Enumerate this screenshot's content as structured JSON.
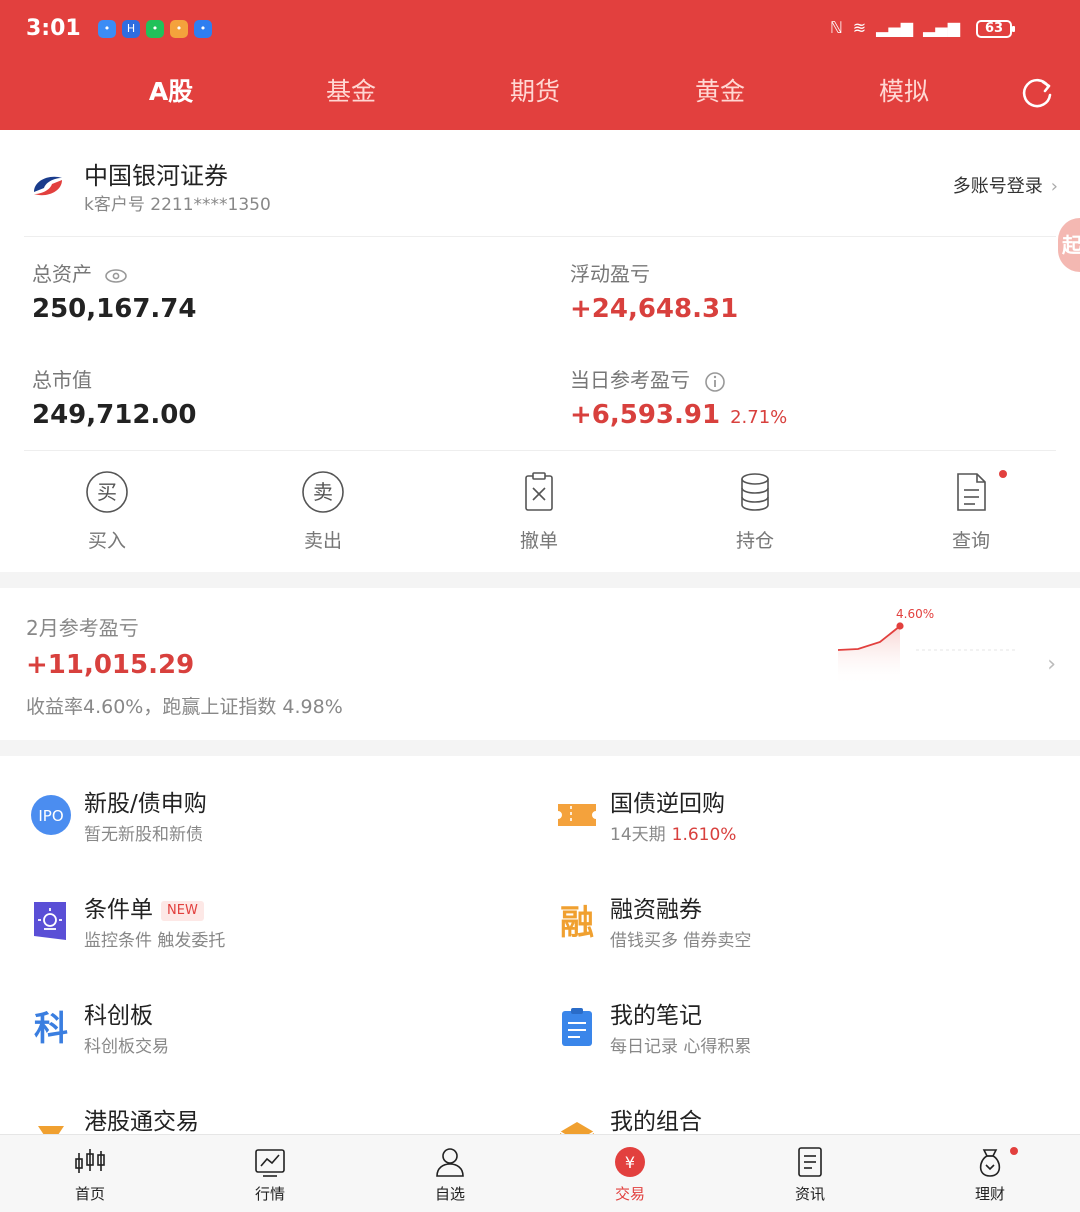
{
  "status_bar": {
    "time": "3:01",
    "battery": "63"
  },
  "tabs": [
    {
      "label": "A股",
      "active": true
    },
    {
      "label": "基金",
      "active": false
    },
    {
      "label": "期货",
      "active": false
    },
    {
      "label": "黄金",
      "active": false
    },
    {
      "label": "模拟",
      "active": false
    }
  ],
  "account": {
    "broker_name": "中国银河证券",
    "client_id": "k客户号 2211****1350",
    "multi_login": "多账号登录",
    "side_tab": "起",
    "total_assets_label": "总资产",
    "total_assets_value": "250,167.74",
    "floating_pl_label": "浮动盈亏",
    "floating_pl_value": "+24,648.31",
    "market_value_label": "总市值",
    "market_value_value": "249,712.00",
    "daily_pl_label": "当日参考盈亏",
    "daily_pl_value": "+6,593.91",
    "daily_pl_pct": "2.71%"
  },
  "actions": [
    {
      "label": "买入",
      "icon": "buy-icon"
    },
    {
      "label": "卖出",
      "icon": "sell-icon"
    },
    {
      "label": "撤单",
      "icon": "cancel-order-icon"
    },
    {
      "label": "持仓",
      "icon": "positions-icon"
    },
    {
      "label": "查询",
      "icon": "query-icon"
    }
  ],
  "monthly": {
    "label": "2月参考盈亏",
    "value": "+11,015.29",
    "desc": "收益率4.60%，跑赢上证指数 4.98%",
    "chart_peak_label": "4.60%"
  },
  "services": [
    {
      "title": "新股/债申购",
      "sub": "暂无新股和新债",
      "icon": "ipo-icon"
    },
    {
      "title": "国债逆回购",
      "sub": "14天期",
      "highlight": "1.610%",
      "icon": "ticket-icon"
    },
    {
      "title": "条件单",
      "badge": "NEW",
      "sub": "监控条件 触发委托",
      "icon": "condition-order-icon"
    },
    {
      "title": "融资融券",
      "sub": "借钱买多 借券卖空",
      "icon": "margin-icon"
    },
    {
      "title": "科创板",
      "sub": "科创板交易",
      "icon": "star-market-icon"
    },
    {
      "title": "我的笔记",
      "sub": "每日记录 心得积累",
      "icon": "notes-icon"
    },
    {
      "title": "港股通交易",
      "icon": "trophy-icon"
    },
    {
      "title": "我的组合",
      "icon": "portfolio-box-icon"
    }
  ],
  "bottom_nav": [
    {
      "label": "首页",
      "icon": "candlestick-icon"
    },
    {
      "label": "行情",
      "icon": "market-chart-icon"
    },
    {
      "label": "自选",
      "icon": "watchlist-icon"
    },
    {
      "label": "交易",
      "icon": "trade-yen-icon",
      "active": true
    },
    {
      "label": "资讯",
      "icon": "news-icon"
    },
    {
      "label": "理财",
      "icon": "money-bag-icon"
    }
  ],
  "colors": {
    "brand_red": "#e2403e",
    "profit_red": "#d8403d"
  }
}
